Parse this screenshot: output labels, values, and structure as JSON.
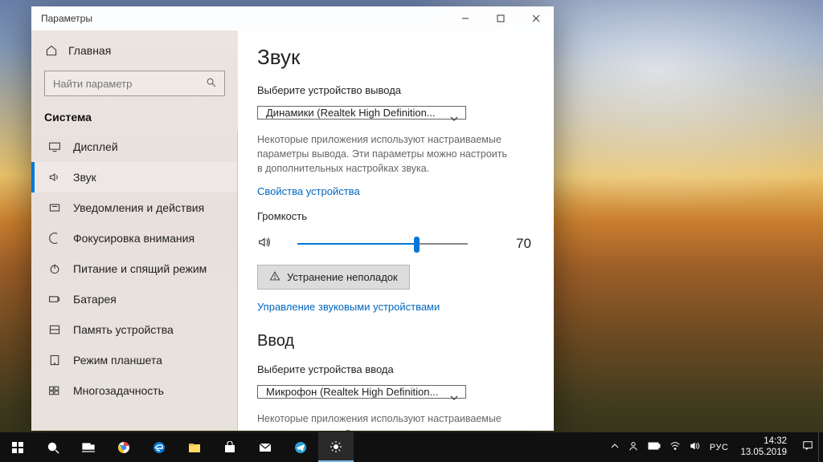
{
  "window": {
    "title": "Параметры"
  },
  "sidebar": {
    "home": "Главная",
    "search_placeholder": "Найти параметр",
    "heading": "Система",
    "items": [
      {
        "label": "Дисплей"
      },
      {
        "label": "Звук"
      },
      {
        "label": "Уведомления и действия"
      },
      {
        "label": "Фокусировка внимания"
      },
      {
        "label": "Питание и спящий режим"
      },
      {
        "label": "Батарея"
      },
      {
        "label": "Память устройства"
      },
      {
        "label": "Режим планшета"
      },
      {
        "label": "Многозадачность"
      }
    ]
  },
  "main": {
    "title": "Звук",
    "output_label": "Выберите устройство вывода",
    "output_device": "Динамики (Realtek High Definition...",
    "output_desc": "Некоторые приложения используют настраиваемые параметры вывода. Эти параметры можно настроить в дополнительных настройках звука.",
    "device_props": "Свойства устройства",
    "volume_label": "Громкость",
    "volume_value": "70",
    "volume_percent": 70,
    "troubleshoot": "Устранение неполадок",
    "manage_devices": "Управление звуковыми устройствами",
    "input_heading": "Ввод",
    "input_label": "Выберите устройства ввода",
    "input_device": "Микрофон (Realtek High Definition...",
    "input_desc": "Некоторые приложения используют настраиваемые параметры ввода. Эти параметры можно настроить в дополнительных настройках звука."
  },
  "taskbar": {
    "lang": "РУС",
    "time": "14:32",
    "date": "13.05.2019"
  }
}
